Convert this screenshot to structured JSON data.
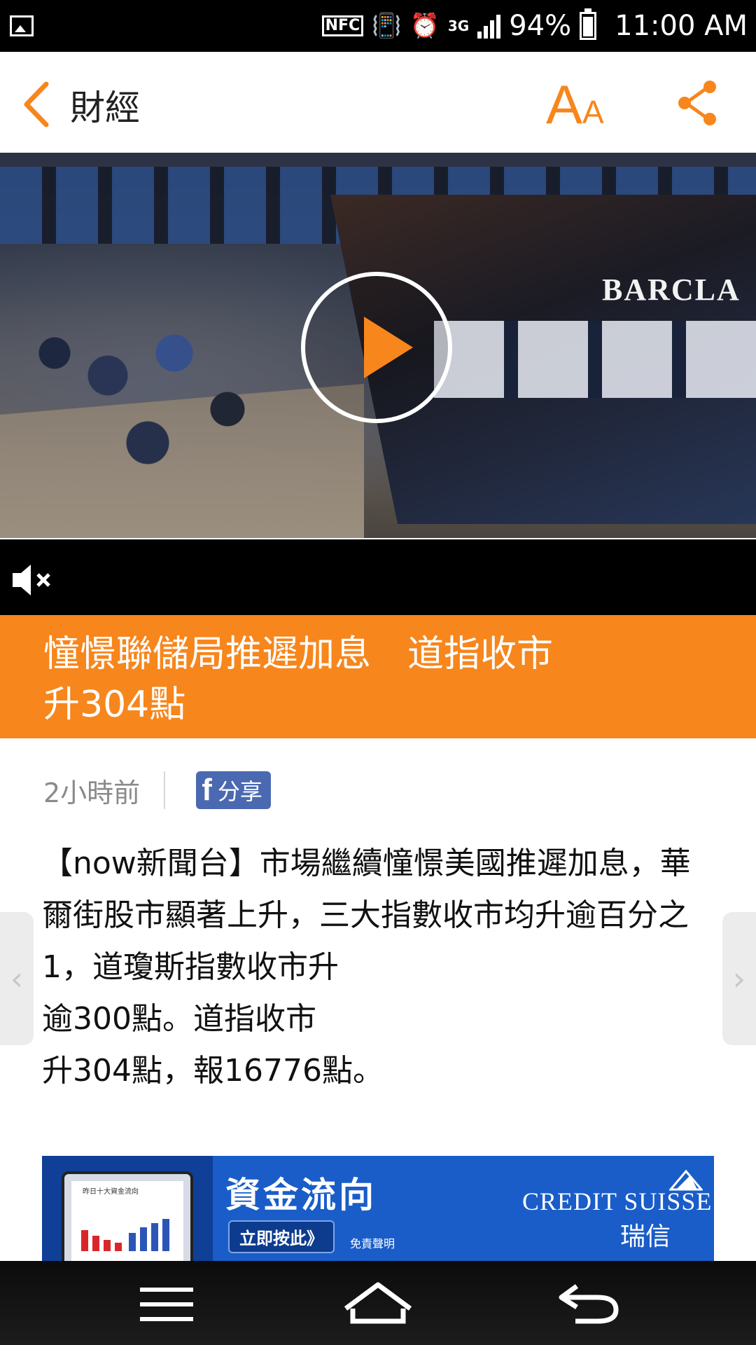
{
  "status_bar": {
    "nfc_label": "NFC",
    "network": "3G",
    "battery_percent": "94%",
    "time": "11:00 AM",
    "icons": [
      "gallery-icon",
      "vibrate-icon",
      "alarm-icon",
      "signal-icon",
      "battery-icon"
    ]
  },
  "app_bar": {
    "title": "財經",
    "font_size_big": "A",
    "font_size_small": "A",
    "accent_color": "#f7861c"
  },
  "video": {
    "brand_text": "BARCLA",
    "icons": [
      "play-icon",
      "mute-icon"
    ]
  },
  "article": {
    "headline": "憧憬聯儲局推遲加息　道指收市\n升304點",
    "time_ago": "2小時前",
    "share_label": "分享",
    "share_brand": "f",
    "paragraphs": [
      "【now新聞台】市場繼續憧憬美國推遲加息，華爾街股市顯著上升，三大指數收市均升逾百分之1，道瓊斯指數收市升",
      "逾300點。道指收市",
      "升304點，報16776點。"
    ],
    "headline_bg": "#f7861c"
  },
  "side_nav": {
    "prev": "‹",
    "next": "›"
  },
  "ad": {
    "screen_title": "昨日十大資金流向",
    "title": "資金流向",
    "button_label": "立即按此》",
    "disclaimer": "免責聲明",
    "brand_en": "CREDIT SUISSE",
    "brand_zh": "瑞信"
  },
  "nav_bar": {
    "icons": [
      "menu-icon",
      "home-icon",
      "back-nav-icon"
    ]
  }
}
